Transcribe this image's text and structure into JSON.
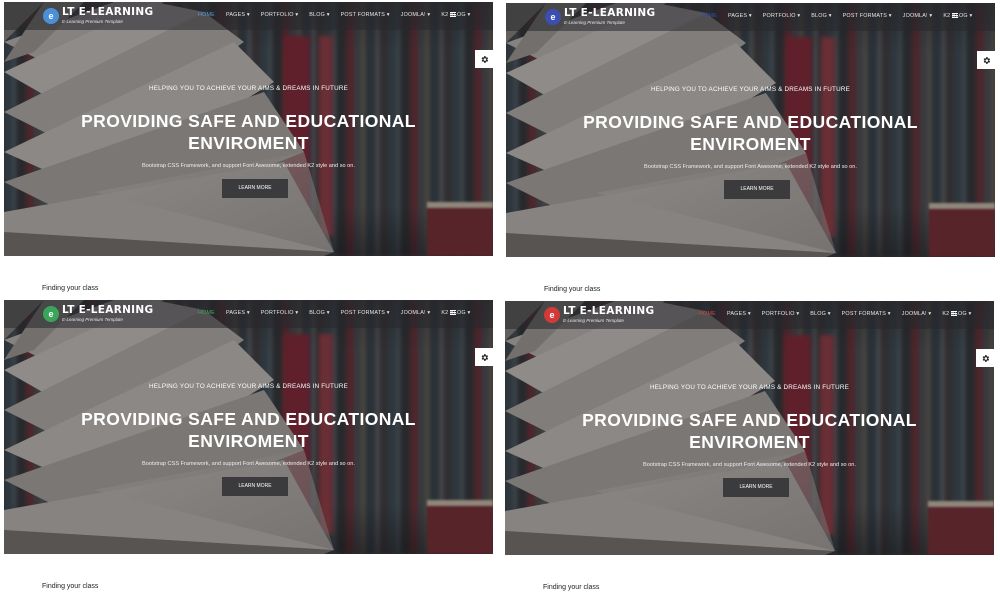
{
  "panels": [
    {
      "logo": {
        "title": "LT E-LEARNING",
        "subtitle": "E-Learning Premium Template",
        "color": "#4a90d9"
      },
      "menu": [
        "HOME",
        "PAGES ▾",
        "PORTFOLIO ▾",
        "BLOG ▾",
        "POST FORMATS ▾",
        "JOOMLA! ▾",
        "K2 BLOG ▾"
      ],
      "active_color": "#5b9bd5",
      "hero": {
        "tagline": "HELPING YOU TO ACHIEVE YOUR AIMS & DREAMS IN FUTURE",
        "title": "PROVIDING SAFE AND EDUCATIONAL ENVIROMENT",
        "subtitle": "Bootstrap CSS Framework, and support Font Awesome, extended K2 style and so on.",
        "button": "LEARN MORE"
      },
      "section_title": "Finding your class"
    },
    {
      "logo": {
        "title": "LT E-LEARNING",
        "subtitle": "E-Learning Premium Template",
        "color": "#3b4fb0"
      },
      "menu": [
        "HOME",
        "PAGES ▾",
        "PORTFOLIO ▾",
        "BLOG ▾",
        "POST FORMATS ▾",
        "JOOMLA! ▾",
        "K2 BLOG ▾"
      ],
      "active_color": "#3b4fb0",
      "hero": {
        "tagline": "HELPING YOU TO ACHIEVE YOUR AIMS & DREAMS IN FUTURE",
        "title": "PROVIDING SAFE AND EDUCATIONAL ENVIROMENT",
        "subtitle": "Bootstrap CSS Framework, and support Font Awesome, extended K2 style and so on.",
        "button": "LEARN MORE"
      },
      "section_title": "Finding your class"
    },
    {
      "logo": {
        "title": "LT E-LEARNING",
        "subtitle": "E-Learning Premium Template",
        "color": "#3aa55a"
      },
      "menu": [
        "HOME",
        "PAGES ▾",
        "PORTFOLIO ▾",
        "BLOG ▾",
        "POST FORMATS ▾",
        "JOOMLA! ▾",
        "K2 BLOG ▾"
      ],
      "active_color": "#46a85f",
      "hero": {
        "tagline": "HELPING YOU TO ACHIEVE YOUR AIMS & DREAMS IN FUTURE",
        "title": "PROVIDING SAFE AND EDUCATIONAL ENVIROMENT",
        "subtitle": "Bootstrap CSS Framework, and support Font Awesome, extended K2 style and so on.",
        "button": "LEARN MORE"
      },
      "section_title": "Finding your class"
    },
    {
      "logo": {
        "title": "LT E-LEARNING",
        "subtitle": "E-Learning Premium Template",
        "color": "#d23a3a"
      },
      "menu": [
        "HOME",
        "PAGES ▾",
        "PORTFOLIO ▾",
        "BLOG ▾",
        "POST FORMATS ▾",
        "JOOMLA! ▾",
        "K2 BLOG ▾"
      ],
      "active_color": "#d64545",
      "hero": {
        "tagline": "HELPING YOU TO ACHIEVE YOUR AIMS & DREAMS IN FUTURE",
        "title": "PROVIDING SAFE AND EDUCATIONAL ENVIROMENT",
        "subtitle": "Bootstrap CSS Framework, and support Font Awesome, extended K2 style and so on.",
        "button": "LEARN MORE"
      },
      "section_title": "Finding your class"
    }
  ],
  "icons": {
    "gear": "gear-icon",
    "menu": "hamburger-menu-icon",
    "logo": "logo-icon"
  }
}
